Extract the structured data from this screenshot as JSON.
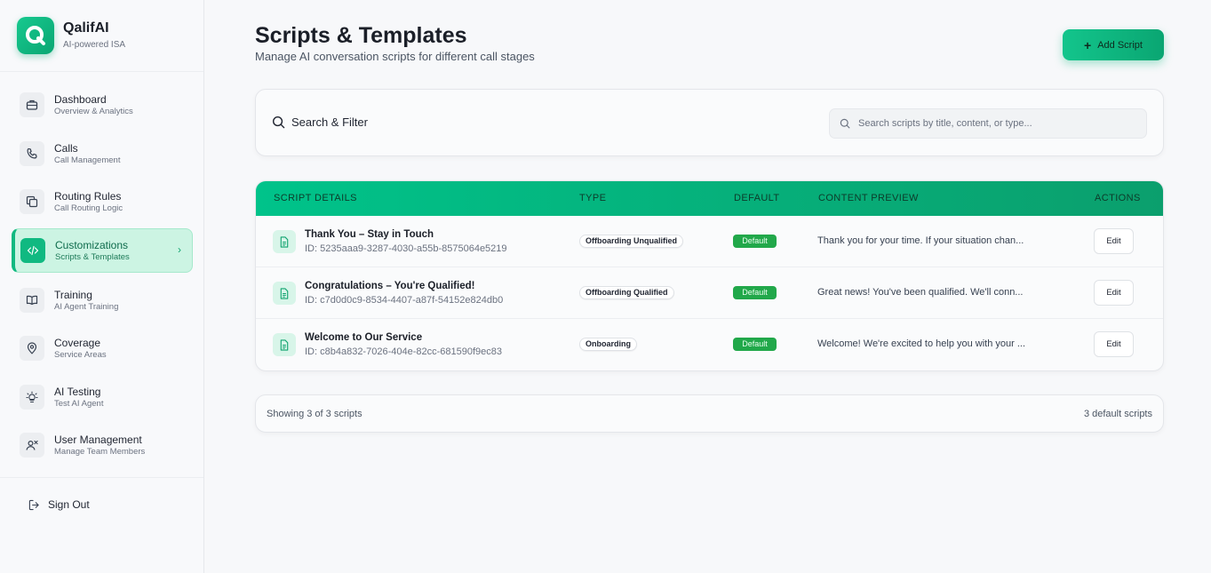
{
  "brand": {
    "name": "QalifAI",
    "tagline": "AI-powered ISA"
  },
  "sidebar": {
    "items": [
      {
        "label": "Dashboard",
        "desc": "Overview & Analytics"
      },
      {
        "label": "Calls",
        "desc": "Call Management"
      },
      {
        "label": "Routing Rules",
        "desc": "Call Routing Logic"
      },
      {
        "label": "Customizations",
        "desc": "Scripts & Templates"
      },
      {
        "label": "Training",
        "desc": "AI Agent Training"
      },
      {
        "label": "Coverage",
        "desc": "Service Areas"
      },
      {
        "label": "AI Testing",
        "desc": "Test AI Agent"
      },
      {
        "label": "User Management",
        "desc": "Manage Team Members"
      }
    ],
    "signout": "Sign Out"
  },
  "header": {
    "title": "Scripts & Templates",
    "subtitle": "Manage AI conversation scripts for different call stages",
    "add_button": "Add Script"
  },
  "filter": {
    "title": "Search & Filter",
    "placeholder": "Search scripts by title, content, or type..."
  },
  "table": {
    "columns": [
      "Script Details",
      "Type",
      "Default",
      "Content Preview",
      "Actions"
    ],
    "rows": [
      {
        "title": "Thank You – Stay in Touch",
        "id": "ID: 5235aaa9-3287-4030-a55b-8575064e5219",
        "type": "Offboarding Unqualified",
        "default": "Default",
        "preview": "Thank you for your time. If your situation chan...",
        "action": "Edit"
      },
      {
        "title": "Congratulations – You're Qualified!",
        "id": "ID: c7d0d0c9-8534-4407-a87f-54152e824db0",
        "type": "Offboarding Qualified",
        "default": "Default",
        "preview": "Great news! You've been qualified. We'll conn...",
        "action": "Edit"
      },
      {
        "title": "Welcome to Our Service",
        "id": "ID: c8b4a832-7026-404e-82cc-681590f9ec83",
        "type": "Onboarding",
        "default": "Default",
        "preview": "Welcome! We're excited to help you with your ...",
        "action": "Edit"
      }
    ]
  },
  "footer": {
    "showing": "Showing 3 of 3 scripts",
    "defaults": "3 default scripts"
  },
  "colors": {
    "accent": "#10b981",
    "default_badge": "#21a84a"
  }
}
